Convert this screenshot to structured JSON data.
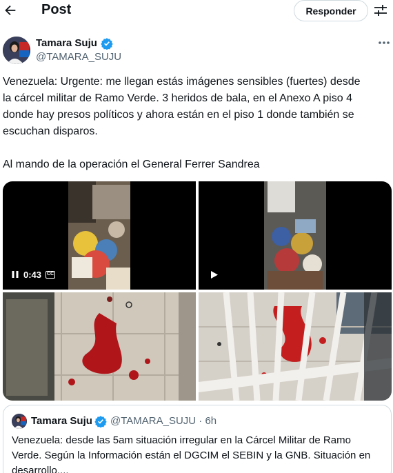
{
  "header": {
    "title": "Post",
    "reply_label": "Responder",
    "icons": [
      "back-arrow-icon",
      "settings-sliders-icon"
    ]
  },
  "author": {
    "name": "Tamara Suju",
    "handle": "@TAMARA_SUJU",
    "verified": true
  },
  "tweet": {
    "lines": [
      "Venezuela: Urgente: me llegan estás imágenes sensibles (fuertes)  desde",
      "la cárcel militar de Ramo Verde. 3 heridos de bala, en el Anexo A piso 4",
      "donde hay presos políticos y ahora están en el piso 1 donde también se",
      "escuchan disparos."
    ],
    "closing": "Al mando de la operación el General Ferrer Sandrea"
  },
  "media": {
    "video_time": "0:43",
    "cc_label": "CC"
  },
  "quote": {
    "name": "Tamara Suju",
    "handle_time": "@TAMARA_SUJU · 6h",
    "lines": [
      "Venezuela:  desde las 5am situación irregular en la Cárcel Militar de Ramo",
      "Verde.  Según la Información están el DGCIM el SEBIN y la GNB.  Situación en",
      "desarrollo...."
    ]
  },
  "colors": {
    "verified_blue": "#1d9bf0",
    "secondary_text": "#536471",
    "border": "#cfd9de"
  }
}
